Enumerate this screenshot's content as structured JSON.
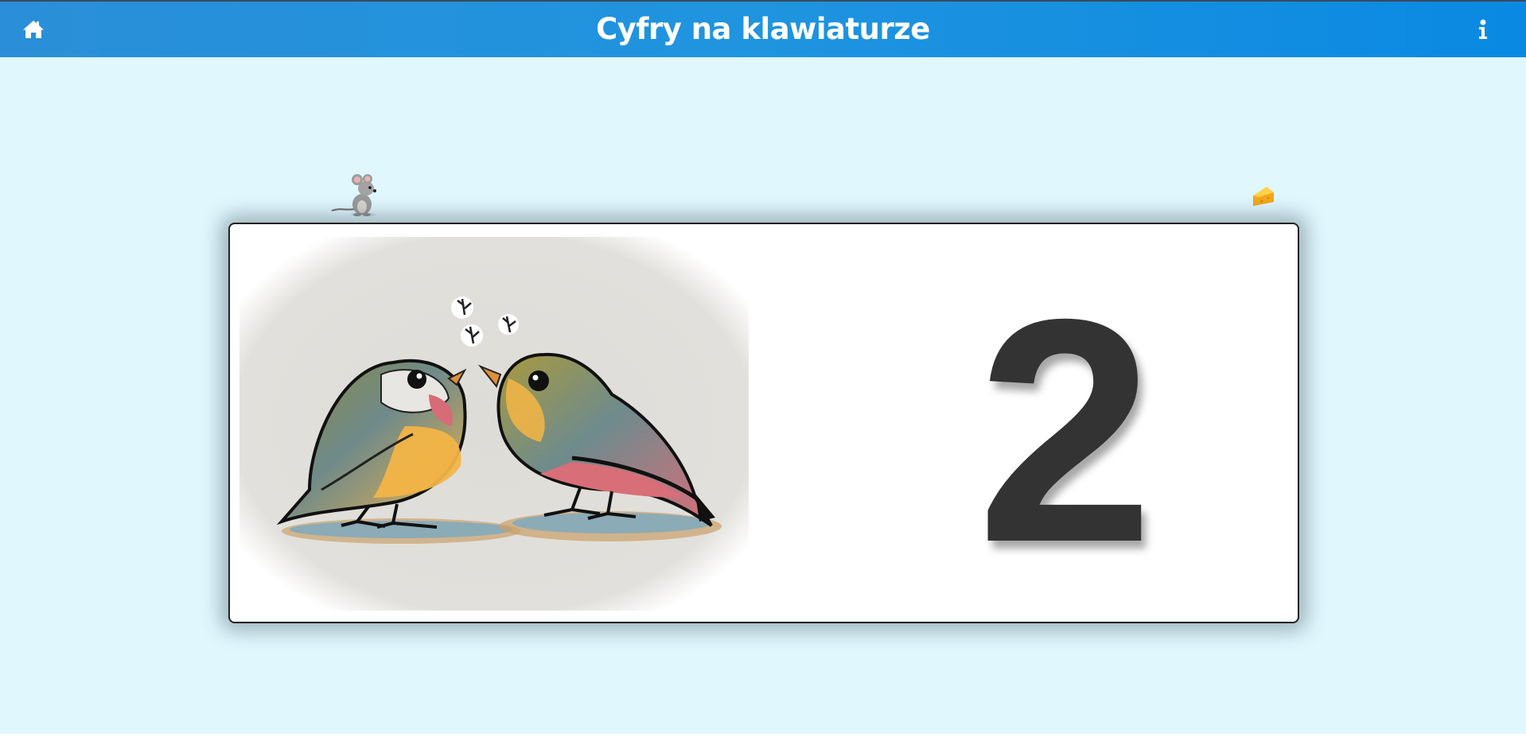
{
  "header": {
    "title": "Cyfry na klawiaturze",
    "home_icon": "home-icon",
    "info_icon": "info-icon"
  },
  "decorations": {
    "mouse": "mouse-icon",
    "cheese": "cheese-icon"
  },
  "card": {
    "image": "two-birds-illustration",
    "digit": "2"
  },
  "colors": {
    "header_start": "#2a8fd8",
    "header_end": "#0a89e2",
    "background": "#e0f7fe",
    "digit": "#333333"
  }
}
